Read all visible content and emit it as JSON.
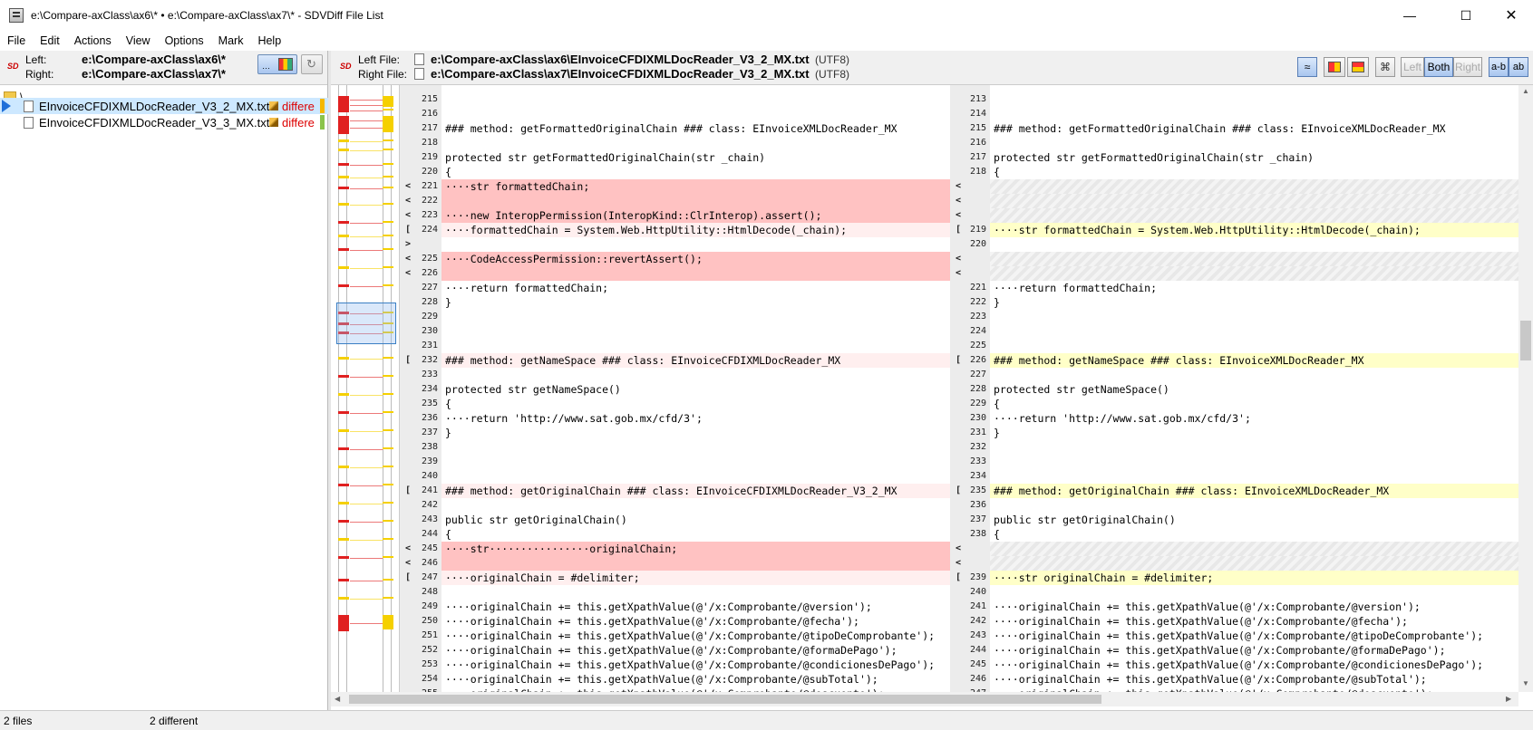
{
  "window": {
    "title": "e:\\Compare-axClass\\ax6\\* • e:\\Compare-axClass\\ax7\\* - SDVDiff File List",
    "minimize": "—",
    "maximize": "☐",
    "close": "✕"
  },
  "menu": [
    "File",
    "Edit",
    "Actions",
    "View",
    "Options",
    "Mark",
    "Help"
  ],
  "left_pane": {
    "logo": "SD",
    "left_label": "Left:",
    "left_path": "e:\\Compare-axClass\\ax6\\*",
    "right_label": "Right:",
    "right_path": "e:\\Compare-axClass\\ax7\\*",
    "root": "\\",
    "files": [
      {
        "name": "EInvoiceCFDIXMLDocReader_V3_2_MX.txt",
        "status": "differe",
        "color": "#f5b800"
      },
      {
        "name": "EInvoiceCFDIXMLDocReader_V3_3_MX.txt",
        "status": "differe",
        "color": "#8bc34a"
      }
    ]
  },
  "diff_header": {
    "logo": "SD",
    "left_file_label": "Left File:",
    "left_file_path": "e:\\Compare-axClass\\ax6\\EInvoiceCFDIXMLDocReader_V3_2_MX.txt",
    "left_encoding": "(UTF8)",
    "right_file_label": "Right File:",
    "right_file_path": "e:\\Compare-axClass\\ax7\\EInvoiceCFDIXMLDocReader_V3_2_MX.txt",
    "right_encoding": "(UTF8)",
    "seg_left": "Left",
    "seg_both": "Both",
    "seg_right": "Right",
    "btn_ab1": "a-b",
    "btn_ab2": "ab"
  },
  "statusbar": {
    "files": "2 files",
    "different": "2 different"
  },
  "left_lines": [
    {
      "n": "215",
      "t": ""
    },
    {
      "n": "216",
      "t": ""
    },
    {
      "n": "217",
      "t": "### method: getFormattedOriginalChain ### class: EInvoiceXMLDocReader_MX"
    },
    {
      "n": "218",
      "t": ""
    },
    {
      "n": "219",
      "t": "protected str getFormattedOriginalChain(str _chain)"
    },
    {
      "n": "220",
      "t": "{"
    },
    {
      "n": "221",
      "t": "····str formattedChain;",
      "k": "del",
      "m": "<"
    },
    {
      "n": "222",
      "t": "",
      "k": "del",
      "m": "<"
    },
    {
      "n": "223",
      "t": "····new InteropPermission(InteropKind::ClrInterop).assert();",
      "k": "del",
      "m": "<"
    },
    {
      "n": "224",
      "t": "····formattedChain = System.Web.HttpUtility::HtmlDecode(_chain);",
      "k": "chg",
      "m": "["
    },
    {
      "n": "",
      "t": "",
      "m": ">"
    },
    {
      "n": "225",
      "t": "····CodeAccessPermission::revertAssert();",
      "k": "del",
      "m": "<"
    },
    {
      "n": "226",
      "t": "",
      "k": "del",
      "m": "<"
    },
    {
      "n": "227",
      "t": "····return formattedChain;"
    },
    {
      "n": "228",
      "t": "}"
    },
    {
      "n": "229",
      "t": ""
    },
    {
      "n": "230",
      "t": ""
    },
    {
      "n": "231",
      "t": ""
    },
    {
      "n": "232",
      "t": "### method: getNameSpace ### class: EInvoiceCFDIXMLDocReader_MX",
      "k": "chg",
      "m": "["
    },
    {
      "n": "233",
      "t": ""
    },
    {
      "n": "234",
      "t": "protected str getNameSpace()"
    },
    {
      "n": "235",
      "t": "{"
    },
    {
      "n": "236",
      "t": "····return 'http://www.sat.gob.mx/cfd/3';"
    },
    {
      "n": "237",
      "t": "}"
    },
    {
      "n": "238",
      "t": ""
    },
    {
      "n": "239",
      "t": ""
    },
    {
      "n": "240",
      "t": ""
    },
    {
      "n": "241",
      "t": "### method: getOriginalChain ### class: EInvoiceCFDIXMLDocReader_V3_2_MX",
      "k": "chg",
      "m": "["
    },
    {
      "n": "242",
      "t": ""
    },
    {
      "n": "243",
      "t": "public str getOriginalChain()"
    },
    {
      "n": "244",
      "t": "{"
    },
    {
      "n": "245",
      "t": "····str················originalChain;",
      "k": "del",
      "m": "<"
    },
    {
      "n": "246",
      "t": "",
      "k": "del",
      "m": "<"
    },
    {
      "n": "247",
      "t": "····originalChain = #delimiter;",
      "k": "chg",
      "m": "["
    },
    {
      "n": "248",
      "t": ""
    },
    {
      "n": "249",
      "t": "····originalChain += this.getXpathValue(@'/x:Comprobante/@version');"
    },
    {
      "n": "250",
      "t": "····originalChain += this.getXpathValue(@'/x:Comprobante/@fecha');"
    },
    {
      "n": "251",
      "t": "····originalChain += this.getXpathValue(@'/x:Comprobante/@tipoDeComprobante');"
    },
    {
      "n": "252",
      "t": "····originalChain += this.getXpathValue(@'/x:Comprobante/@formaDePago');"
    },
    {
      "n": "253",
      "t": "····originalChain += this.getXpathValue(@'/x:Comprobante/@condicionesDePago');"
    },
    {
      "n": "254",
      "t": "····originalChain += this.getXpathValue(@'/x:Comprobante/@subTotal');"
    },
    {
      "n": "255",
      "t": "····originalChain += this.getXpathValue(@'/x:Comprobante/@descuento');"
    }
  ],
  "right_lines": [
    {
      "n": "213",
      "t": ""
    },
    {
      "n": "214",
      "t": ""
    },
    {
      "n": "215",
      "t": "### method: getFormattedOriginalChain ### class: EInvoiceXMLDocReader_MX"
    },
    {
      "n": "216",
      "t": ""
    },
    {
      "n": "217",
      "t": "protected str getFormattedOriginalChain(str _chain)"
    },
    {
      "n": "218",
      "t": "{"
    },
    {
      "n": "",
      "t": "",
      "k": "hatch",
      "m": "<"
    },
    {
      "n": "",
      "t": "",
      "k": "hatch",
      "m": "<"
    },
    {
      "n": "",
      "t": "",
      "k": "hatch",
      "m": "<"
    },
    {
      "n": "219",
      "t": "····str formattedChain = System.Web.HttpUtility::HtmlDecode(_chain);",
      "k": "ychg",
      "m": "["
    },
    {
      "n": "220",
      "t": ""
    },
    {
      "n": "",
      "t": "",
      "k": "hatch",
      "m": "<"
    },
    {
      "n": "",
      "t": "",
      "k": "hatch",
      "m": "<"
    },
    {
      "n": "221",
      "t": "····return formattedChain;"
    },
    {
      "n": "222",
      "t": "}"
    },
    {
      "n": "223",
      "t": ""
    },
    {
      "n": "224",
      "t": ""
    },
    {
      "n": "225",
      "t": ""
    },
    {
      "n": "226",
      "t": "### method: getNameSpace ### class: EInvoiceXMLDocReader_MX",
      "k": "ychg",
      "m": "["
    },
    {
      "n": "227",
      "t": ""
    },
    {
      "n": "228",
      "t": "protected str getNameSpace()"
    },
    {
      "n": "229",
      "t": "{"
    },
    {
      "n": "230",
      "t": "····return 'http://www.sat.gob.mx/cfd/3';"
    },
    {
      "n": "231",
      "t": "}"
    },
    {
      "n": "232",
      "t": ""
    },
    {
      "n": "233",
      "t": ""
    },
    {
      "n": "234",
      "t": ""
    },
    {
      "n": "235",
      "t": "### method: getOriginalChain ### class: EInvoiceXMLDocReader_MX",
      "k": "ychg",
      "m": "["
    },
    {
      "n": "236",
      "t": ""
    },
    {
      "n": "237",
      "t": "public str getOriginalChain()"
    },
    {
      "n": "238",
      "t": "{"
    },
    {
      "n": "",
      "t": "",
      "k": "hatch",
      "m": "<"
    },
    {
      "n": "",
      "t": "",
      "k": "hatch",
      "m": "<"
    },
    {
      "n": "239",
      "t": "····str originalChain = #delimiter;",
      "k": "ychg",
      "m": "["
    },
    {
      "n": "240",
      "t": ""
    },
    {
      "n": "241",
      "t": "····originalChain += this.getXpathValue(@'/x:Comprobante/@version');"
    },
    {
      "n": "242",
      "t": "····originalChain += this.getXpathValue(@'/x:Comprobante/@fecha');"
    },
    {
      "n": "243",
      "t": "····originalChain += this.getXpathValue(@'/x:Comprobante/@tipoDeComprobante');"
    },
    {
      "n": "244",
      "t": "····originalChain += this.getXpathValue(@'/x:Comprobante/@formaDePago');"
    },
    {
      "n": "245",
      "t": "····originalChain += this.getXpathValue(@'/x:Comprobante/@condicionesDePago');"
    },
    {
      "n": "246",
      "t": "····originalChain += this.getXpathValue(@'/x:Comprobante/@subTotal');"
    },
    {
      "n": "247",
      "t": "····originalChain += this.getXpathValue(@'/x:Comprobante/@descuento');"
    }
  ],
  "colors": {
    "deleted": "#ffc2c2",
    "changed_left": "#ffefef",
    "changed_right": "#ffffc8",
    "marker_red": "#e02020",
    "marker_yellow": "#f5d000"
  }
}
